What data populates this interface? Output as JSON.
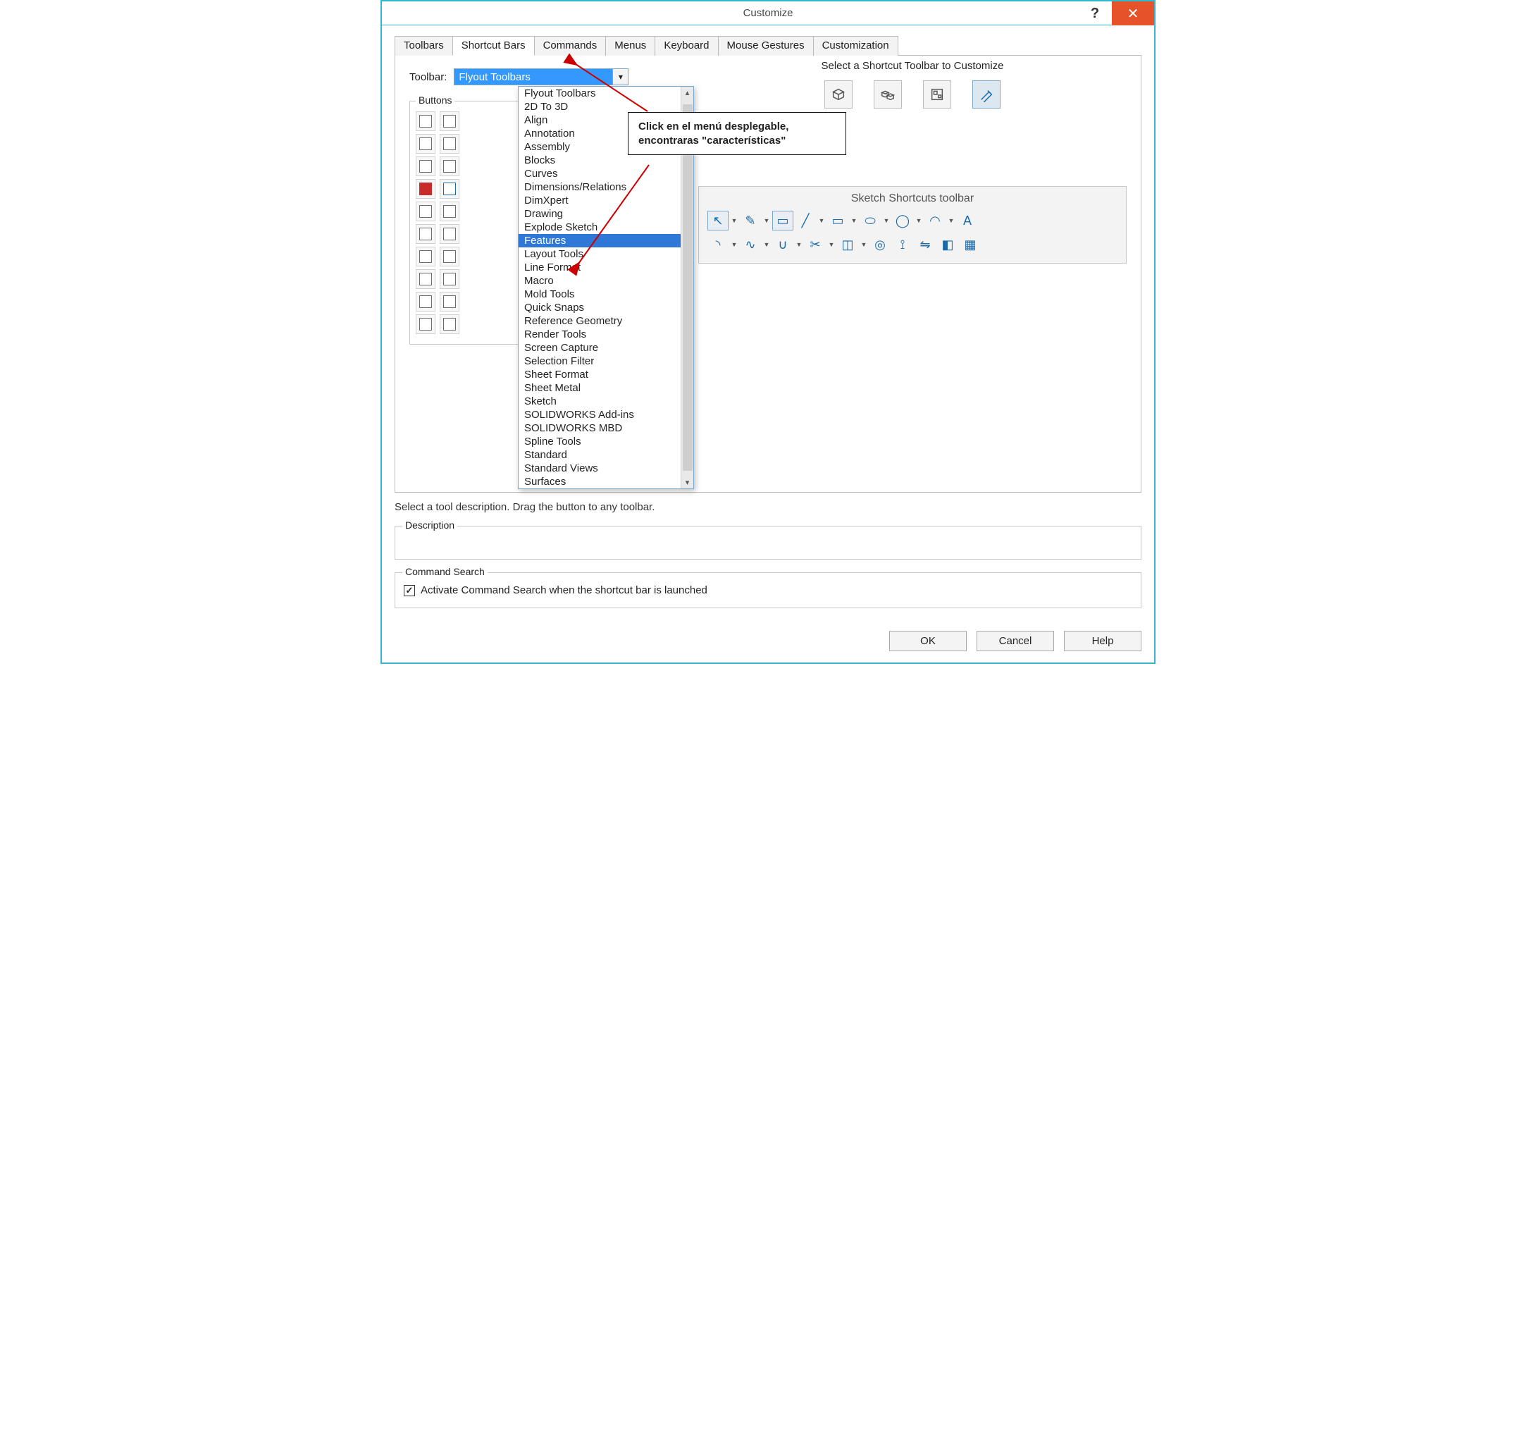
{
  "title": "Customize",
  "titlebar": {
    "help_glyph": "?",
    "close_glyph": "✕"
  },
  "tabs": [
    {
      "label": "Toolbars"
    },
    {
      "label": "Shortcut Bars",
      "active": true
    },
    {
      "label": "Commands"
    },
    {
      "label": "Menus"
    },
    {
      "label": "Keyboard"
    },
    {
      "label": "Mouse Gestures"
    },
    {
      "label": "Customization"
    }
  ],
  "toolbar_label": "Toolbar:",
  "combo": {
    "selected": "Flyout Toolbars"
  },
  "dropdown_items": [
    "Flyout Toolbars",
    "2D To 3D",
    "Align",
    "Annotation",
    "Assembly",
    "Blocks",
    "Curves",
    "Dimensions/Relations",
    "DimXpert",
    "Drawing",
    "Explode Sketch",
    "Features",
    "Layout Tools",
    "Line Format",
    "Macro",
    "Mold Tools",
    "Quick Snaps",
    "Reference Geometry",
    "Render Tools",
    "Screen Capture",
    "Selection Filter",
    "Sheet Format",
    "Sheet Metal",
    "Sketch",
    "SOLIDWORKS Add-ins",
    "SOLIDWORKS MBD",
    "Spline Tools",
    "Standard",
    "Standard Views",
    "Surfaces"
  ],
  "dropdown_highlight": "Features",
  "buttons_group_legend": "Buttons",
  "right": {
    "title": "Select a Shortcut Toolbar to Customize",
    "sketch_panel_title": "Sketch Shortcuts toolbar"
  },
  "shortcut_icons": [
    {
      "name": "part-shortcut-icon",
      "selected": false
    },
    {
      "name": "assembly-shortcut-icon",
      "selected": false
    },
    {
      "name": "drawing-shortcut-icon",
      "selected": false
    },
    {
      "name": "sketch-shortcut-icon",
      "selected": true
    }
  ],
  "callout": {
    "line1": "Click en el menú desplegable,",
    "line2": "encontraras \"características\""
  },
  "hint": "Select a tool                                           description. Drag the button to any toolbar.",
  "description_label": "Description",
  "cmd_search": {
    "legend": "Command Search",
    "checkbox_checked": true,
    "label": "Activate Command Search when the shortcut bar is launched"
  },
  "footer": {
    "ok": "OK",
    "cancel": "Cancel",
    "help": "Help"
  },
  "sketch_tools_row1": [
    {
      "name": "select-tool-icon",
      "glyph": "↖",
      "sel": true,
      "caret": true
    },
    {
      "name": "smart-dimension-icon",
      "glyph": "✎",
      "caret": true
    },
    {
      "name": "corner-rectangle-icon",
      "glyph": "▭",
      "sel": true,
      "caret": false
    },
    {
      "name": "line-icon",
      "glyph": "╱",
      "caret": true
    },
    {
      "name": "rectangle-icon",
      "glyph": "▭",
      "caret": true
    },
    {
      "name": "slot-icon",
      "glyph": "⬭",
      "caret": true
    },
    {
      "name": "circle-icon",
      "glyph": "◯",
      "caret": true
    },
    {
      "name": "arc-icon",
      "glyph": "◠",
      "caret": true
    },
    {
      "name": "text-icon",
      "glyph": "A",
      "caret": false
    }
  ],
  "sketch_tools_row2": [
    {
      "name": "fillet-icon",
      "glyph": "◝",
      "caret": true
    },
    {
      "name": "spline-icon",
      "glyph": "∿",
      "caret": true
    },
    {
      "name": "parabola-icon",
      "glyph": "∪",
      "caret": true
    },
    {
      "name": "trim-icon",
      "glyph": "✂",
      "caret": true
    },
    {
      "name": "box-icon",
      "glyph": "◫",
      "caret": true
    },
    {
      "name": "offset-icon",
      "glyph": "◎",
      "caret": false
    },
    {
      "name": "mirror-left-icon",
      "glyph": "⟟",
      "caret": false
    },
    {
      "name": "mirror-icon",
      "glyph": "⇋",
      "caret": false
    },
    {
      "name": "cube-icon",
      "glyph": "◧",
      "caret": false
    },
    {
      "name": "grid-icon",
      "glyph": "▦",
      "caret": false
    }
  ]
}
